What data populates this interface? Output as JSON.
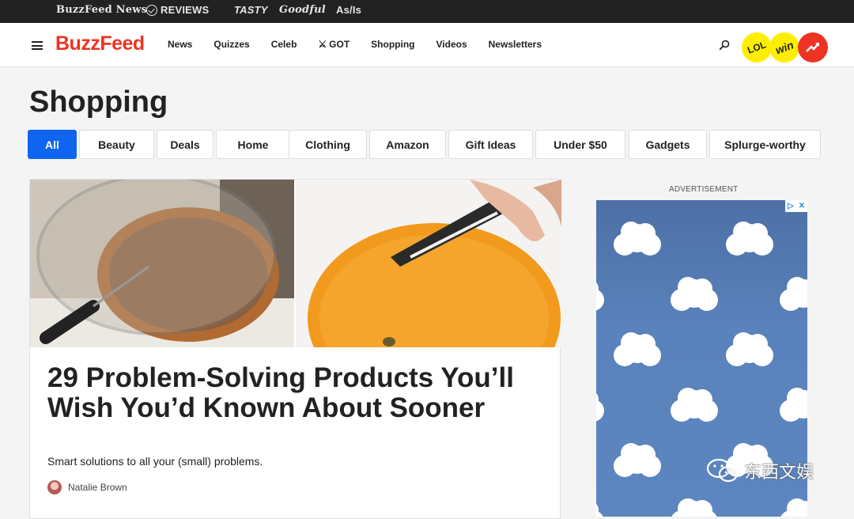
{
  "topbar": {
    "brands": [
      "BuzzFeed News",
      "REVIEWS",
      "TASTY",
      "Goodful",
      "As/Is"
    ]
  },
  "nav": {
    "logo": "BuzzFeed",
    "links": [
      "News",
      "Quizzes",
      "Celeb",
      "GOT",
      "Shopping",
      "Videos",
      "Newsletters"
    ],
    "badges": {
      "lol": "LOL",
      "win": "win"
    }
  },
  "page": {
    "title": "Shopping"
  },
  "filters": [
    "All",
    "Beauty",
    "Deals",
    "Home",
    "Clothing",
    "Amazon",
    "Gift Ideas",
    "Under $50",
    "Gadgets",
    "Splurge-worthy"
  ],
  "article": {
    "title": "29 Problem-Solving Products You’ll Wish You’d Known About Sooner",
    "subtitle": "Smart solutions to all your (small) problems.",
    "author": "Natalie Brown"
  },
  "ad": {
    "label": "ADVERTISEMENT"
  },
  "watermark": {
    "text": "东西文娱"
  },
  "colors": {
    "brand_red": "#ee3322",
    "active_chip": "#0f65ef",
    "topbar_bg": "#222222",
    "badge_yellow": "#ffee00"
  }
}
